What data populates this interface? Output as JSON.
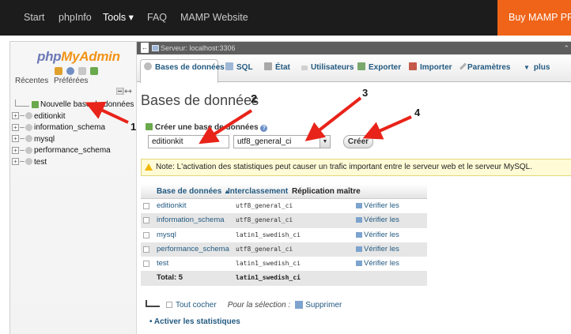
{
  "topnav": {
    "items": [
      "Start",
      "phpInfo",
      "Tools ▾",
      "FAQ",
      "MAMP Website"
    ],
    "buy": "Buy MAMP PRO"
  },
  "nav": {
    "logo_php": "php",
    "logo_myadmin": "MyAdmin",
    "tabs": [
      "Récentes",
      "Préférées"
    ],
    "new_db": "Nouvelle base de données",
    "databases": [
      "editionkit",
      "information_schema",
      "mysql",
      "performance_schema",
      "test"
    ]
  },
  "breadcrumb": {
    "server": "Serveur: localhost:3306"
  },
  "tabs": [
    "Bases de données",
    "SQL",
    "État",
    "Utilisateurs",
    "Exporter",
    "Importer",
    "Paramètres",
    "plus"
  ],
  "main": {
    "title": "Bases de données",
    "create_label": "Créer une base de données",
    "db_name_value": "editionkit",
    "collation_value": "utf8_general_ci",
    "create_button": "Créer",
    "notice": "Note: L'activation des statistiques peut causer un trafic important entre le serveur web et le serveur MySQL."
  },
  "table": {
    "headers": [
      "Base de données",
      "Interclassement",
      "Réplication maître"
    ],
    "rows": [
      {
        "name": "editionkit",
        "collation": "utf8_general_ci",
        "action": "Vérifier les privilèges"
      },
      {
        "name": "information_schema",
        "collation": "utf8_general_ci",
        "action": "Vérifier les privilèges"
      },
      {
        "name": "mysql",
        "collation": "latin1_swedish_ci",
        "action": "Vérifier les privilèges"
      },
      {
        "name": "performance_schema",
        "collation": "utf8_general_ci",
        "action": "Vérifier les privilèges"
      },
      {
        "name": "test",
        "collation": "latin1_swedish_ci",
        "action": "Vérifier les privilèges"
      }
    ],
    "total_label": "Total: 5",
    "total_collation": "latin1_swedish_ci"
  },
  "bulk": {
    "check_all": "Tout cocher",
    "for_selection": "Pour la sélection :",
    "delete": "Supprimer"
  },
  "activate_stats": "Activer les statistiques",
  "annotations": [
    "1",
    "2",
    "3",
    "4"
  ],
  "colors": {
    "topnav_bg": "#1c1c1c",
    "buy_bg": "#ef6418",
    "link": "#235a81",
    "arrow": "#e8231a",
    "notice_bg": "#fffbd6"
  }
}
